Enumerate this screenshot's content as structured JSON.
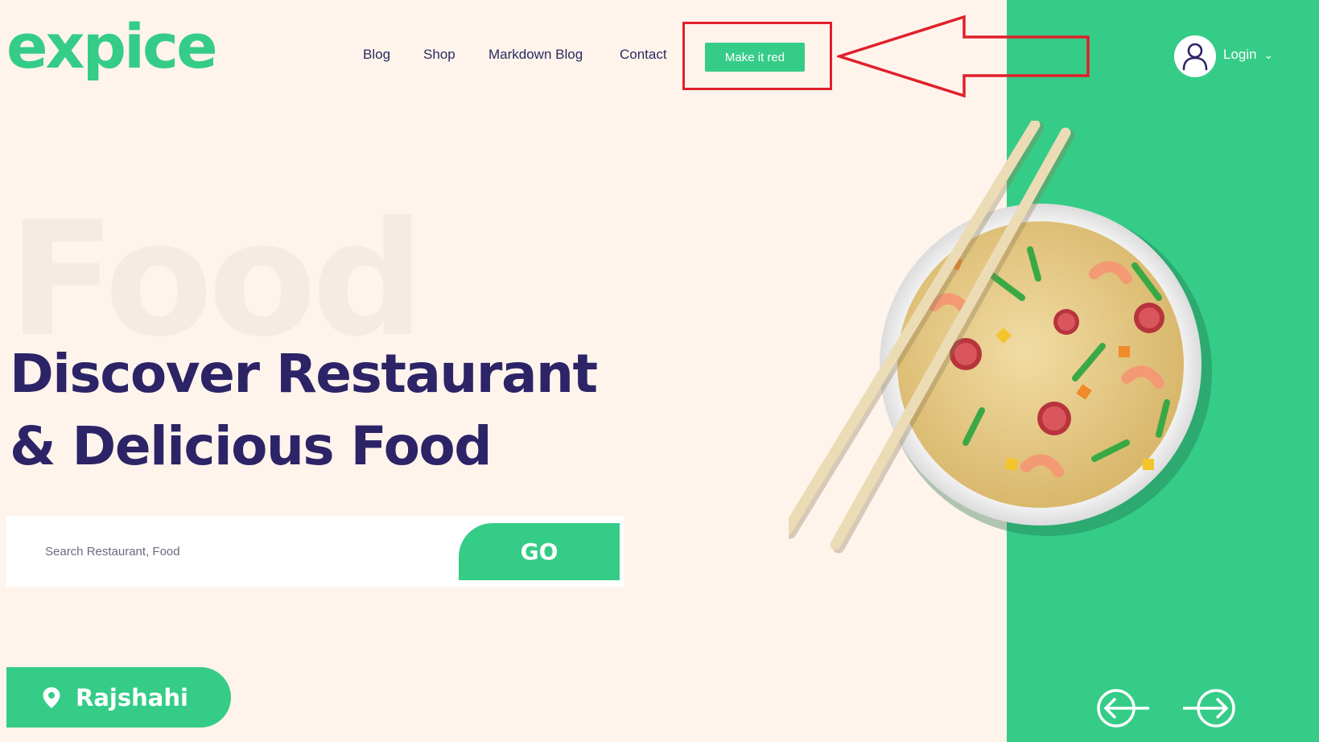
{
  "brand": {
    "logo": "expice"
  },
  "nav": {
    "links": [
      "Blog",
      "Shop",
      "Markdown Blog",
      "Contact"
    ],
    "cta_label": "Make it red"
  },
  "account": {
    "login_label": "Login",
    "dropdown_caret": "⌄"
  },
  "hero": {
    "watermark": "Food",
    "headline_line1": "Discover Restaurant",
    "headline_line2": "& Delicious Food"
  },
  "search": {
    "placeholder": "Search Restaurant, Food",
    "value": "",
    "go_label": "GO"
  },
  "location": {
    "label": "Rajshahi",
    "icon": "map-pin-icon"
  },
  "carousel": {
    "prev_icon": "arrow-left-circle-icon",
    "next_icon": "arrow-right-circle-icon"
  },
  "colors": {
    "brand_green": "#35cc87",
    "headline_navy": "#2c2467",
    "background_cream": "#fff4ec",
    "annotation_red": "#e0202a"
  }
}
